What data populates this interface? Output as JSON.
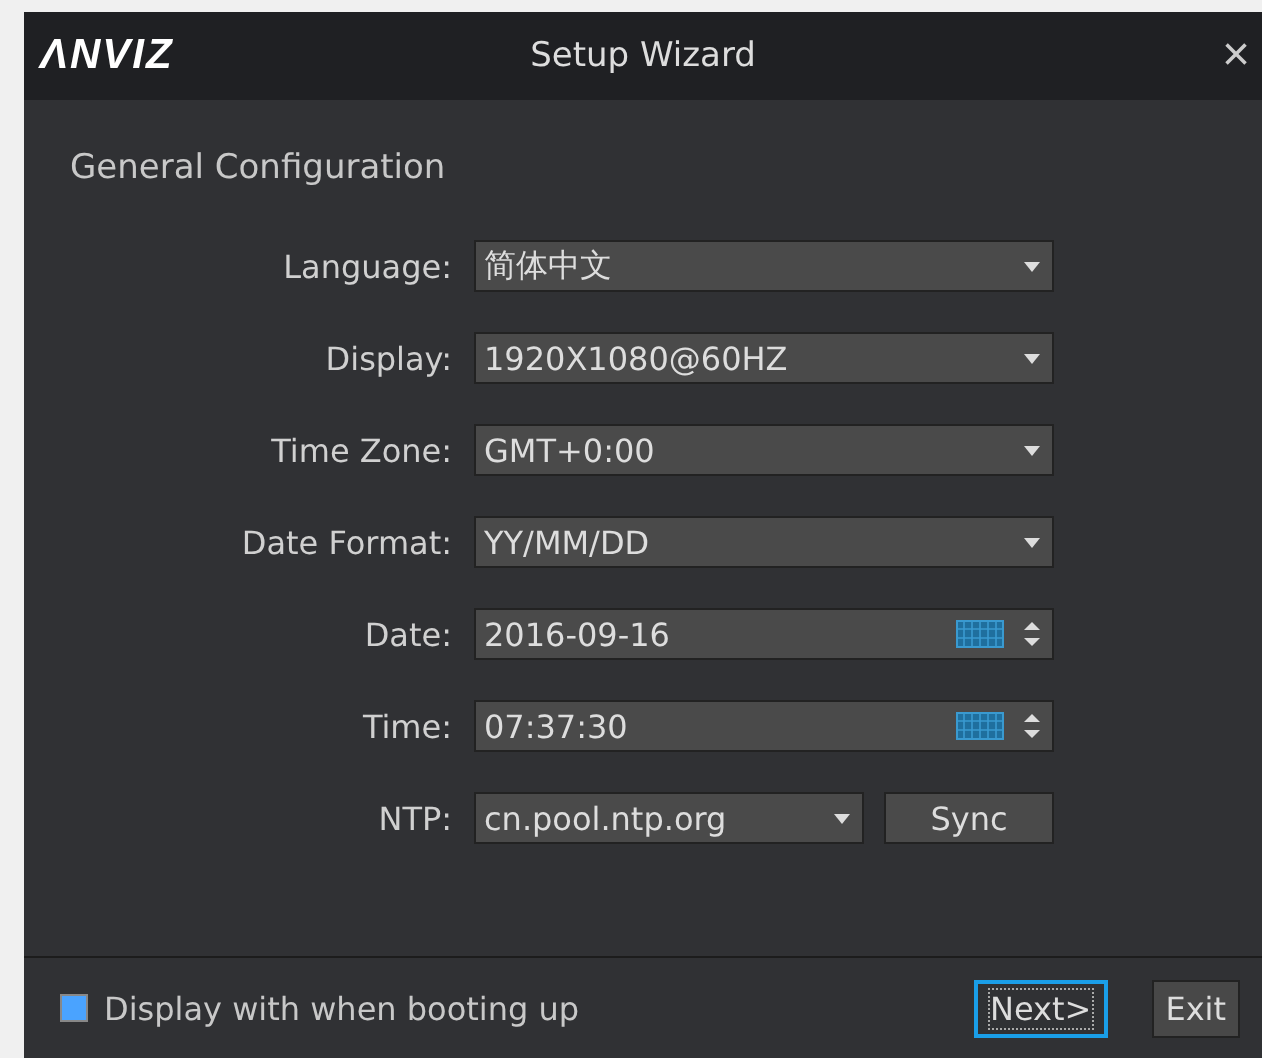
{
  "window": {
    "logo": "ΛNVIZ",
    "title": "Setup Wizard",
    "close": "×"
  },
  "section_title": "General Configuration",
  "fields": [
    {
      "label": "Language:",
      "kind": "dropdown",
      "value": "简体中文"
    },
    {
      "label": "Display:",
      "kind": "dropdown",
      "value": "1920X1080@60HZ"
    },
    {
      "label": "Time Zone:",
      "kind": "dropdown",
      "value": "GMT+0:00"
    },
    {
      "label": "Date Format:",
      "kind": "dropdown",
      "value": "YY/MM/DD"
    },
    {
      "label": "Date:",
      "kind": "spin",
      "value": "2016-09-16"
    },
    {
      "label": "Time:",
      "kind": "spin",
      "value": "07:37:30"
    },
    {
      "label": "NTP:",
      "kind": "dropdown_button",
      "value": "cn.pool.ntp.org",
      "button": "Sync"
    }
  ],
  "footer": {
    "checkbox": {
      "label": "Display with when booting up",
      "checked": true
    },
    "buttons": [
      {
        "label": "Next>",
        "focused": true
      },
      {
        "label": "Exit",
        "focused": false
      }
    ]
  }
}
